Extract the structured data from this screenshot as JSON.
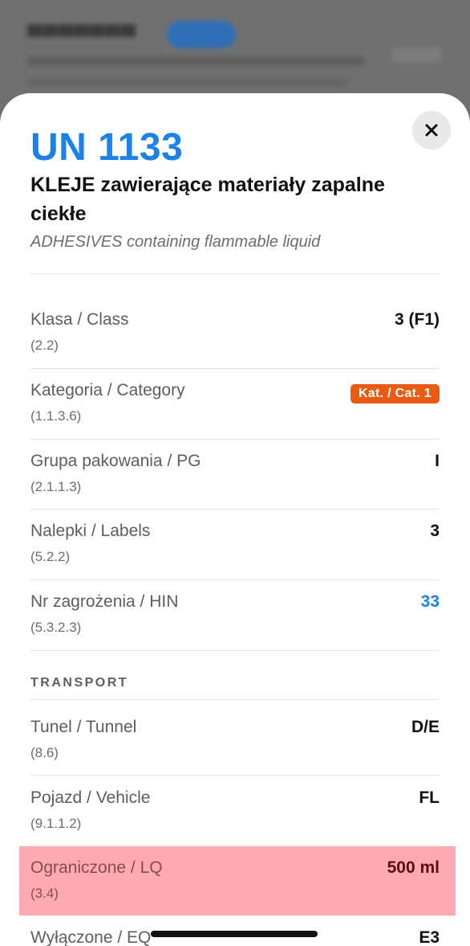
{
  "sheet": {
    "un_number": "UN 1133",
    "name_pl": "KLEJE zawierające materiały zapalne ciekłe",
    "name_en": "ADHESIVES containing flammable liquid",
    "close_icon": "×"
  },
  "properties": [
    {
      "label": "Klasa / Class",
      "ref": "(2.2)",
      "value": "3 (F1)"
    },
    {
      "label": "Kategoria / Category",
      "ref": "(1.1.3.6)",
      "value": "Kat. / Cat. 1",
      "style": "badge",
      "color": "#ea5a12"
    },
    {
      "label": "Grupa pakowania / PG",
      "ref": "(2.1.1.3)",
      "value": "I"
    },
    {
      "label": "Nalepki / Labels",
      "ref": "(5.2.2)",
      "value": "3"
    },
    {
      "label": "Nr zagrożenia / HIN",
      "ref": "(5.3.2.3)",
      "value": "33",
      "color": "#1a82e8"
    }
  ],
  "transport": {
    "title": "TRANSPORT",
    "rows": [
      {
        "label": "Tunel / Tunnel",
        "ref": "(8.6)",
        "value": "D/E"
      },
      {
        "label": "Pojazd / Vehicle",
        "ref": "(9.1.1.2)",
        "value": "FL"
      },
      {
        "label": "Ograniczone / LQ",
        "ref": "(3.4)",
        "value": "500 ml",
        "highlight": "#ffaab0"
      },
      {
        "label": "Wyłączone / EQ",
        "value": "E3"
      }
    ]
  }
}
